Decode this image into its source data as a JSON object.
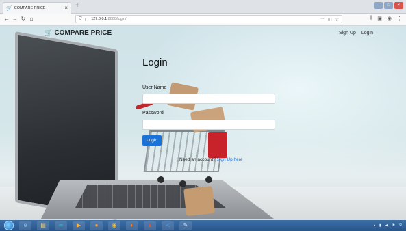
{
  "browser": {
    "tab_title": "COMPARE PRICE",
    "url_host": "127.0.0.1",
    "url_path": ":8000/login/"
  },
  "header": {
    "brand": "COMPARE PRICE",
    "signup_link": "Sign Up",
    "login_link": "Login"
  },
  "login": {
    "title": "Login",
    "username_label": "User Name",
    "password_label": "Password",
    "username_value": "",
    "password_value": "",
    "submit_label": "Login",
    "no_account_text": "Need an account?",
    "signup_here": "Sign Up here"
  },
  "colors": {
    "primary": "#1a73d9",
    "cart_red": "#c8222b",
    "taskbar": "#27558a"
  }
}
